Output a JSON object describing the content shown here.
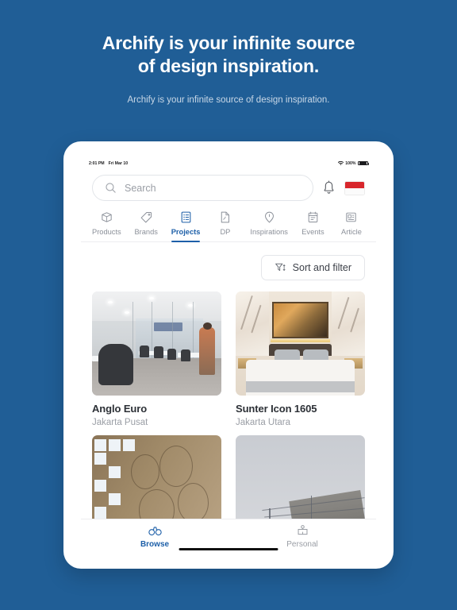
{
  "promo": {
    "title_line1": "Archify is your infinite source",
    "title_line2": "of design inspiration.",
    "subtitle": "Archify is your infinite source of design inspiration.",
    "background_color": "#205E96"
  },
  "device": {
    "statusbar": {
      "time": "2:01 PM",
      "date": "Fri Mar 10",
      "wifi_icon": "wifi-icon",
      "battery_percent": "100%",
      "battery_icon": "battery-full-icon"
    }
  },
  "header": {
    "search": {
      "icon": "search-icon",
      "placeholder": "Search",
      "value": ""
    },
    "notification_icon": "bell-icon",
    "flag": {
      "name": "indonesia-flag-icon",
      "top_color": "#D8262C",
      "bottom_color": "#FBFBFB"
    }
  },
  "tabs": {
    "active_index": 2,
    "active_color": "#1D5FA8",
    "inactive_color": "#8B9099",
    "items": [
      {
        "label": "Products",
        "icon": "box-icon"
      },
      {
        "label": "Brands",
        "icon": "tag-icon"
      },
      {
        "label": "Projects",
        "icon": "list-document-icon"
      },
      {
        "label": "DP",
        "icon": "folded-document-icon"
      },
      {
        "label": "Inspirations",
        "icon": "lightbulb-pin-icon"
      },
      {
        "label": "Events",
        "icon": "calendar-icon"
      },
      {
        "label": "Article",
        "icon": "article-icon"
      }
    ]
  },
  "toolbar": {
    "sort_filter_label": "Sort and filter",
    "sort_filter_icon": "filter-sort-icon"
  },
  "projects": [
    {
      "title": "Anglo Euro",
      "location": "Jakarta Pusat",
      "image_alt": "office-interior-glass-partition-meeting-room"
    },
    {
      "title": "Sunter Icon 1605",
      "location": "Jakarta Utara",
      "image_alt": "luxury-bedroom-marble-wall-artwork"
    },
    {
      "title": "",
      "location": "",
      "image_alt": "decorative-mosaic-tile-pattern"
    },
    {
      "title": "",
      "location": "",
      "image_alt": "overcast-sky-roof-edge-power-lines"
    }
  ],
  "bottom_nav": {
    "active_index": 0,
    "items": [
      {
        "label": "Browse",
        "icon": "binoculars-icon"
      },
      {
        "label": "Personal",
        "icon": "person-badge-icon"
      }
    ]
  }
}
